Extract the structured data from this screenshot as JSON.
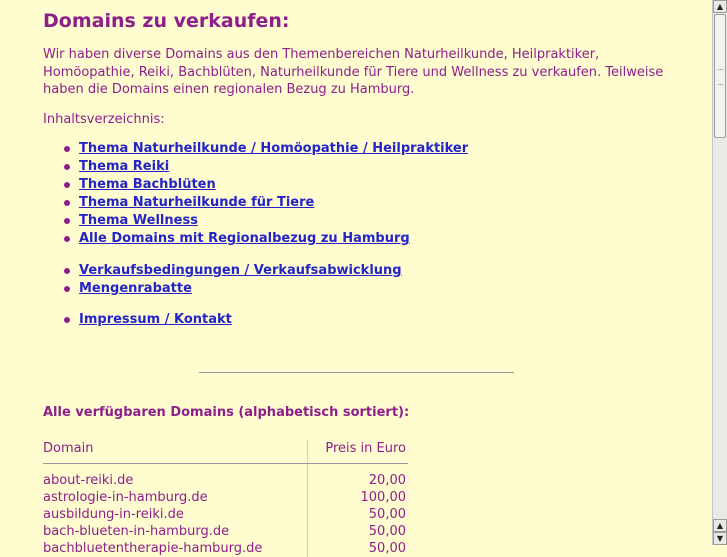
{
  "page": {
    "title": "Domains zu verkaufen:",
    "intro": "Wir haben diverse Domains aus den Themenbereichen Naturheilkunde, Heilpraktiker, Homöopathie, Reiki, Bachblüten, Naturheilkunde für Tiere und Wellness zu verkaufen. Teilweise haben die Domains einen regionalen Bezug zu Hamburg.",
    "toc_label": "Inhaltsverzeichnis:",
    "toc_group1": [
      "Thema Naturheilkunde / Homöopathie / Heilpraktiker",
      "Thema Reiki",
      "Thema Bachblüten",
      "Thema Naturheilkunde für Tiere",
      "Thema Wellness",
      "Alle Domains mit Regionalbezug zu Hamburg"
    ],
    "toc_group2": [
      "Verkaufsbedingungen / Verkaufsabwicklung",
      "Mengenrabatte"
    ],
    "toc_group3": [
      "Impressum / Kontakt"
    ],
    "domains_title": "Alle verfügbaren Domains (alphabetisch sortiert):",
    "table": {
      "headers": [
        "Domain",
        "Preis in Euro"
      ],
      "rows": [
        [
          "about-reiki.de",
          "20,00"
        ],
        [
          "astrologie-in-hamburg.de",
          "100,00"
        ],
        [
          "ausbildung-in-reiki.de",
          "50,00"
        ],
        [
          "bach-blueten-in-hamburg.de",
          "50,00"
        ],
        [
          "bachbluetentherapie-hamburg.de",
          "50,00"
        ]
      ]
    }
  },
  "colors": {
    "background": "#fffdd0",
    "text": "#8e1e8a",
    "link": "#2424c8"
  }
}
